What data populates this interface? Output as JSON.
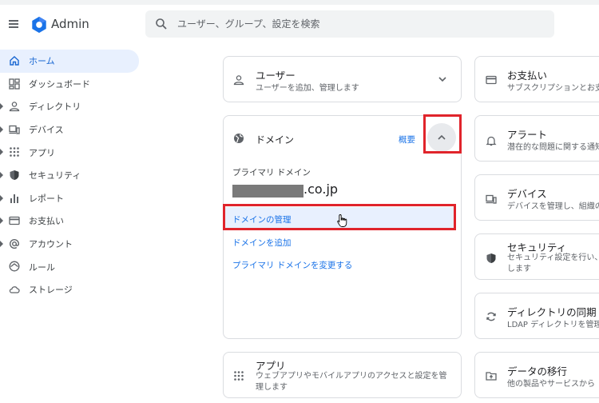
{
  "app": {
    "brand": "Admin"
  },
  "search": {
    "placeholder": "ユーザー、グループ、設定を検索"
  },
  "sidebar": {
    "items": [
      {
        "label": "ホーム",
        "icon": "home-icon",
        "active": true,
        "expandable": false
      },
      {
        "label": "ダッシュボード",
        "icon": "dashboard-icon",
        "active": false,
        "expandable": false
      },
      {
        "label": "ディレクトリ",
        "icon": "person-icon",
        "active": false,
        "expandable": true
      },
      {
        "label": "デバイス",
        "icon": "devices-icon",
        "active": false,
        "expandable": true
      },
      {
        "label": "アプリ",
        "icon": "apps-grid-icon",
        "active": false,
        "expandable": true
      },
      {
        "label": "セキュリティ",
        "icon": "shield-icon",
        "active": false,
        "expandable": true
      },
      {
        "label": "レポート",
        "icon": "bar-chart-icon",
        "active": false,
        "expandable": true
      },
      {
        "label": "お支払い",
        "icon": "credit-card-icon",
        "active": false,
        "expandable": true
      },
      {
        "label": "アカウント",
        "icon": "at-icon",
        "active": false,
        "expandable": true
      },
      {
        "label": "ルール",
        "icon": "rules-icon",
        "active": false,
        "expandable": false
      },
      {
        "label": "ストレージ",
        "icon": "cloud-icon",
        "active": false,
        "expandable": false
      }
    ]
  },
  "cards": {
    "users": {
      "title": "ユーザー",
      "subtitle": "ユーザーを追加、管理します"
    },
    "domain": {
      "title": "ドメイン",
      "overview_link": "概要",
      "primary_label": "プライマリ ドメイン",
      "primary_value": ".co.jp",
      "links": {
        "manage": "ドメインの管理",
        "add": "ドメインを追加",
        "change_primary": "プライマリ ドメインを変更する"
      }
    },
    "apps": {
      "title": "アプリ",
      "subtitle": "ウェブアプリやモバイルアプリのアクセスと設定を管理します"
    },
    "billing": {
      "title": "お支払い",
      "subtitle": "サブスクリプションとお支"
    },
    "alerts": {
      "title": "アラート",
      "subtitle": "潜在的な問題に関する通知"
    },
    "devices": {
      "title": "デバイス",
      "subtitle": "デバイスを管理し、組織の"
    },
    "security": {
      "title": "セキュリティ",
      "subtitle": "セキュリティ設定を行い、します"
    },
    "dirsync": {
      "title": "ディレクトリの同期",
      "subtitle": "LDAP ディレクトリを管理"
    },
    "migration": {
      "title": "データの移行",
      "subtitle": "他の製品やサービスから"
    }
  },
  "colors": {
    "accent": "#1a73e8",
    "highlight": "#e0242b",
    "active_nav_bg": "#e8f0fe"
  }
}
